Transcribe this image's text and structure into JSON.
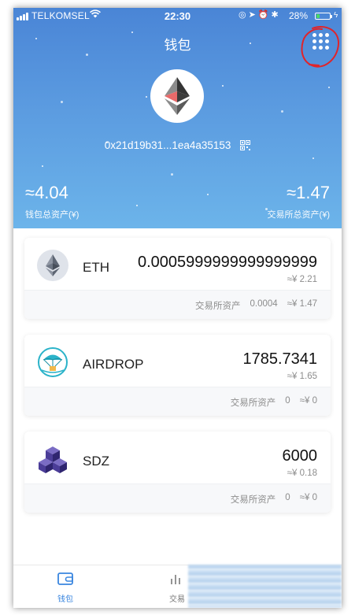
{
  "status_bar": {
    "carrier": "TELKOMSEL",
    "time": "22:30",
    "battery": "28%",
    "battery_level": 0.28
  },
  "header": {
    "title": "钱包",
    "address": "0x21d19b31...1ea4a35153",
    "wallet_total_value": "≈4.04",
    "wallet_total_label": "钱包总资产(¥)",
    "exchange_total_value": "≈1.47",
    "exchange_total_label": "交易所总资产(¥)"
  },
  "tokens": [
    {
      "symbol": "ETH",
      "icon": "ethereum-icon",
      "amount": "0.0005999999999999999",
      "fiat": "≈¥ 2.21",
      "exchange_label": "交易所资产",
      "exchange_amount": "0.0004",
      "exchange_fiat": "≈¥ 1.47"
    },
    {
      "symbol": "AIRDROP",
      "icon": "airdrop-parachute-icon",
      "amount": "1785.7341",
      "fiat": "≈¥ 1.65",
      "exchange_label": "交易所资产",
      "exchange_amount": "0",
      "exchange_fiat": "≈¥ 0"
    },
    {
      "symbol": "SDZ",
      "icon": "sdz-cubes-icon",
      "amount": "6000",
      "fiat": "≈¥ 0.18",
      "exchange_label": "交易所资产",
      "exchange_amount": "0",
      "exchange_fiat": "≈¥ 0"
    }
  ],
  "tabs": [
    {
      "label": "钱包",
      "icon": "wallet-icon",
      "active": true
    },
    {
      "label": "交易",
      "icon": "chart-icon",
      "active": false
    }
  ],
  "colors": {
    "header_top": "#4a85d6",
    "header_bottom": "#6cb4ea",
    "accent": "#3a86df",
    "annotation": "#e0242a"
  }
}
